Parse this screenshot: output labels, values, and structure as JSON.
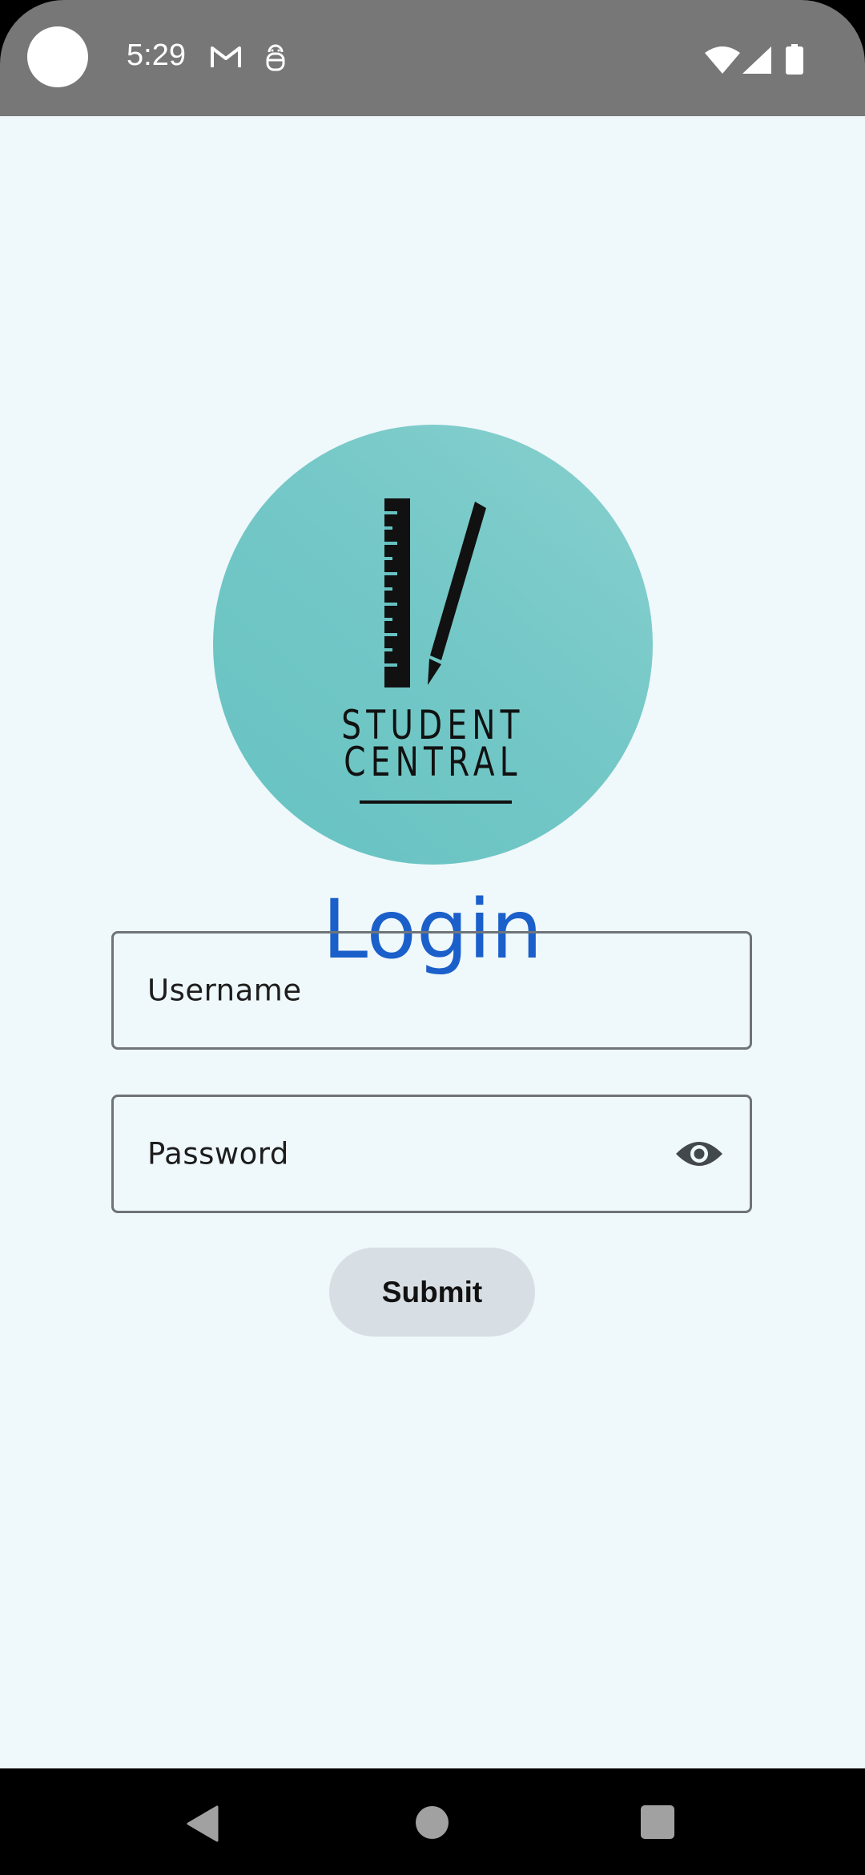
{
  "status_bar": {
    "time": "5:29",
    "icons_left": [
      "gmail-icon",
      "bug-icon"
    ],
    "icons_right": [
      "wifi-icon",
      "cell-signal-icon",
      "battery-icon"
    ]
  },
  "logo": {
    "line1": "STUDENT",
    "line2": "CENTRAL",
    "colors": {
      "circle": "#74c8c7",
      "art": "#111111"
    }
  },
  "login": {
    "title": "Login",
    "title_color": "#1b5fca"
  },
  "form": {
    "username_placeholder": "Username",
    "password_placeholder": "Password",
    "submit_label": "Submit"
  },
  "nav_bar": {
    "buttons": [
      "back-icon",
      "home-icon",
      "recents-icon"
    ]
  }
}
